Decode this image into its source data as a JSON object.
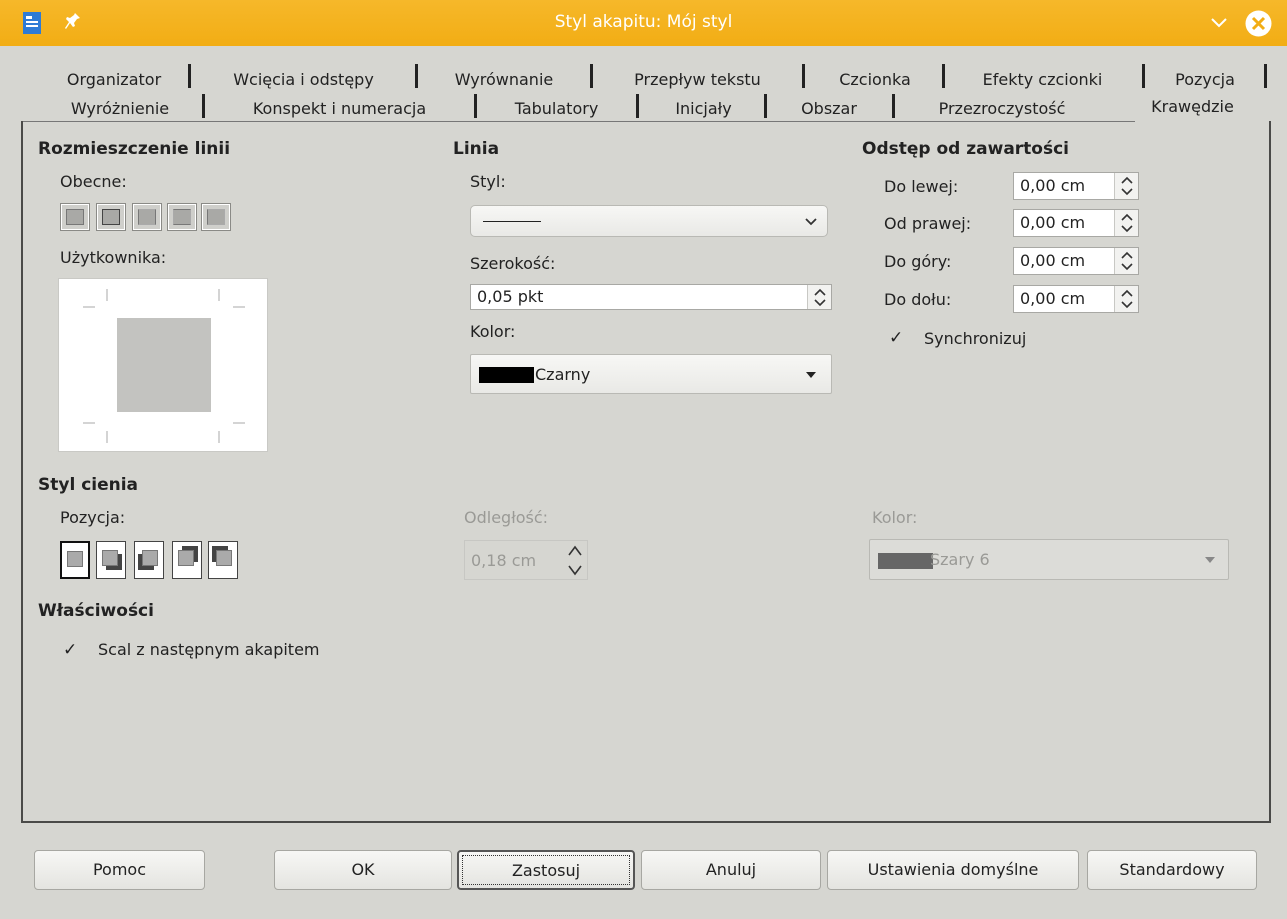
{
  "window": {
    "title": "Styl akapitu: Mój styl"
  },
  "tabs_row1": [
    "Organizator",
    "Wcięcia i odstępy",
    "Wyrównanie",
    "Przepływ tekstu",
    "Czcionka",
    "Efekty czcionki",
    "Pozycja"
  ],
  "tabs_row2": [
    "Wyróżnienie",
    "Konspekt i numeracja",
    "Tabulatory",
    "Inicjały",
    "Obszar",
    "Przezroczystość",
    "Krawędzie"
  ],
  "active_tab": "Krawędzie",
  "line_arrangement": {
    "heading": "Rozmieszczenie linii",
    "current_label": "Obecne:",
    "user_label": "Użytkownika:"
  },
  "line": {
    "heading": "Linia",
    "style_label": "Styl:",
    "style_value": "———",
    "width_label": "Szerokość:",
    "width_value": "0,05 pkt",
    "color_label": "Kolor:",
    "color_value": "Czarny",
    "color_swatch": "#000000"
  },
  "padding": {
    "heading": "Odstęp od zawartości",
    "left_label": "Do lewej:",
    "left_value": "0,00 cm",
    "right_label": "Od prawej:",
    "right_value": "0,00 cm",
    "top_label": "Do góry:",
    "top_value": "0,00 cm",
    "bottom_label": "Do dołu:",
    "bottom_value": "0,00 cm",
    "sync_label": "Synchronizuj",
    "sync_checked": true
  },
  "shadow": {
    "heading": "Styl cienia",
    "position_label": "Pozycja:",
    "distance_label": "Odległość:",
    "distance_value": "0,18 cm",
    "color_label": "Kolor:",
    "color_value": "Szary 6",
    "color_swatch": "#666666"
  },
  "properties": {
    "heading": "Właściwości",
    "merge_label": "Scal z następnym akapitem",
    "merge_checked": true
  },
  "buttons": {
    "help": "Pomoc",
    "ok": "OK",
    "apply": "Zastosuj",
    "cancel": "Anuluj",
    "user_defaults": "Ustawienia domyślne",
    "standard": "Standardowy"
  },
  "colors": {
    "titlebar": "#f2ad14",
    "dialog_bg": "#d6d6d1"
  }
}
